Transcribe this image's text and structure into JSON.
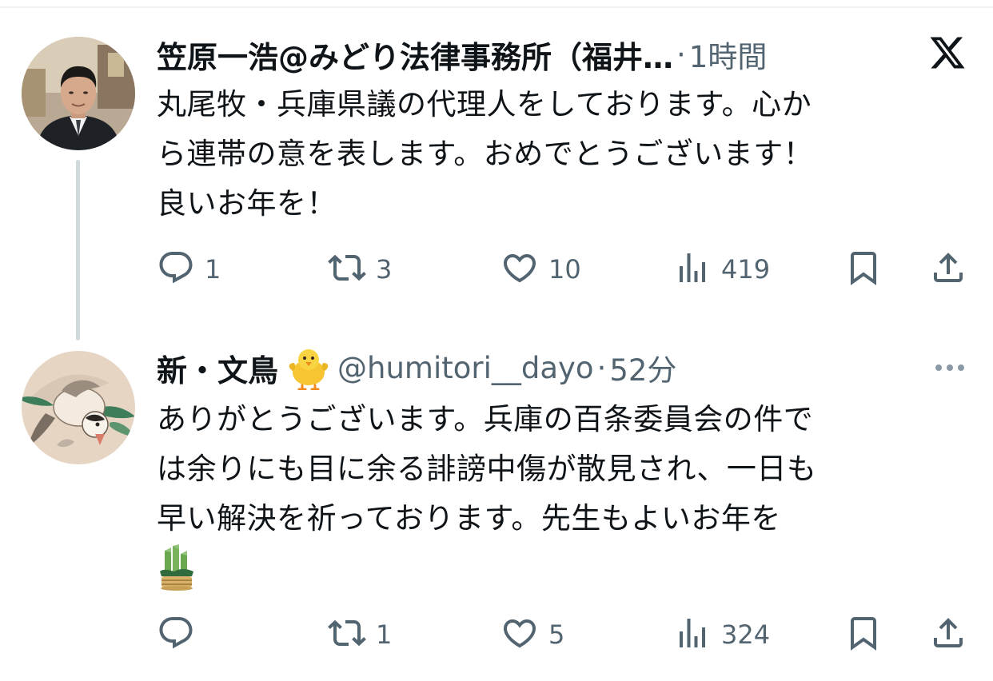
{
  "tweets": [
    {
      "author_name": "笠原一浩@みどり法律事務所（福井…",
      "handle": "",
      "separator": "·",
      "time": "1時間",
      "text_lines": [
        "丸尾牧・兵庫県議の代理人をしております。心か",
        "ら連帯の意を表します。おめでとうございます！",
        "良いお年を！"
      ],
      "reply_count": "1",
      "retweet_count": "3",
      "like_count": "10",
      "view_count": "419"
    },
    {
      "author_name": "新・文鳥",
      "name_emoji": "chick-emoji",
      "handle": "@humitori__dayo",
      "separator": "·",
      "time": "52分",
      "text_lines": [
        "ありがとうございます。兵庫の百条委員会の件で",
        "は余りにも目に余る誹謗中傷が散見され、一日も",
        "早い解決を祈っております。先生もよいお年を"
      ],
      "trailing_emoji": "kadomatsu-emoji",
      "reply_count": "",
      "retweet_count": "1",
      "like_count": "5",
      "view_count": "324"
    }
  ],
  "icons": {
    "header": "x-logo-icon",
    "menu": "more-icon",
    "reply": "reply-icon",
    "retweet": "retweet-icon",
    "like": "like-icon",
    "views": "views-icon",
    "bookmark": "bookmark-icon",
    "share": "share-icon"
  },
  "colors": {
    "text": "#0f1419",
    "secondary": "#536471",
    "thread_line": "#cfd9de",
    "background": "#ffffff"
  }
}
